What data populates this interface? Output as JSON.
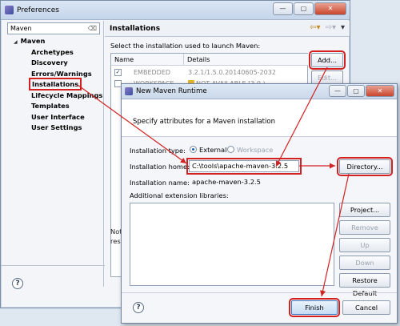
{
  "main_window": {
    "title": "Preferences",
    "filter_value": "Maven",
    "tree": [
      {
        "label": "Maven",
        "level": 0
      },
      {
        "label": "Archetypes",
        "level": 1
      },
      {
        "label": "Discovery",
        "level": 1
      },
      {
        "label": "Errors/Warnings",
        "level": 1
      },
      {
        "label": "Installations",
        "level": 1,
        "selected": true
      },
      {
        "label": "Lifecycle Mappings",
        "level": 1
      },
      {
        "label": "Templates",
        "level": 1
      },
      {
        "label": "User Interface",
        "level": 1
      },
      {
        "label": "User Settings",
        "level": 1
      }
    ],
    "page_title": "Installations",
    "page_subtitle": "Select the installation used to launch Maven:",
    "table": {
      "columns": [
        "Name",
        "Details"
      ],
      "rows": [
        {
          "checked": true,
          "name": "EMBEDDED",
          "details": "3.2.1/1.5.0.20140605-2032"
        },
        {
          "checked": false,
          "name": "WORKSPACE",
          "details": "NOT AVAILABLE [3.0,)"
        }
      ]
    },
    "buttons": {
      "add": "Add...",
      "edit": "Edit..."
    },
    "note_text": [
      "Not",
      "res"
    ],
    "help_glyph": "?"
  },
  "dialog": {
    "title": "New Maven Runtime",
    "message": "Specify attributes for a Maven installation",
    "installation_type_label": "Installation type:",
    "type_external": "External",
    "type_workspace": "Workspace",
    "installation_home_label": "Installation home:",
    "installation_home_value": "C:\\tools\\apache-maven-3.2.5",
    "installation_name_label": "Installation name:",
    "installation_name_value": "apache-maven-3.2.5",
    "libraries_label": "Additional extension libraries:",
    "buttons": {
      "directory": "Directory...",
      "project": "Project...",
      "remove": "Remove",
      "up": "Up",
      "down": "Down",
      "restore_default": "Restore Default",
      "finish": "Finish",
      "cancel": "Cancel"
    },
    "help_glyph": "?"
  },
  "colors": {
    "highlight": "#d32020",
    "accent": "#1d5fa8"
  }
}
